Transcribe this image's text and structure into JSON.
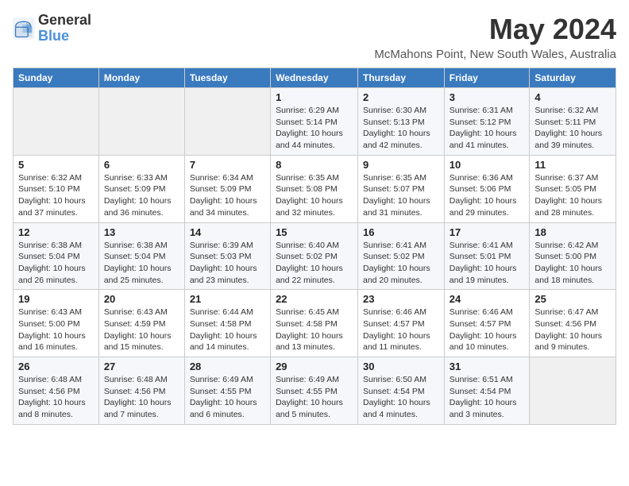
{
  "logo": {
    "line1": "General",
    "line2": "Blue"
  },
  "title": "May 2024",
  "location": "McMahons Point, New South Wales, Australia",
  "days_of_week": [
    "Sunday",
    "Monday",
    "Tuesday",
    "Wednesday",
    "Thursday",
    "Friday",
    "Saturday"
  ],
  "weeks": [
    [
      {
        "day": "",
        "info": ""
      },
      {
        "day": "",
        "info": ""
      },
      {
        "day": "",
        "info": ""
      },
      {
        "day": "1",
        "info": "Sunrise: 6:29 AM\nSunset: 5:14 PM\nDaylight: 10 hours\nand 44 minutes."
      },
      {
        "day": "2",
        "info": "Sunrise: 6:30 AM\nSunset: 5:13 PM\nDaylight: 10 hours\nand 42 minutes."
      },
      {
        "day": "3",
        "info": "Sunrise: 6:31 AM\nSunset: 5:12 PM\nDaylight: 10 hours\nand 41 minutes."
      },
      {
        "day": "4",
        "info": "Sunrise: 6:32 AM\nSunset: 5:11 PM\nDaylight: 10 hours\nand 39 minutes."
      }
    ],
    [
      {
        "day": "5",
        "info": "Sunrise: 6:32 AM\nSunset: 5:10 PM\nDaylight: 10 hours\nand 37 minutes."
      },
      {
        "day": "6",
        "info": "Sunrise: 6:33 AM\nSunset: 5:09 PM\nDaylight: 10 hours\nand 36 minutes."
      },
      {
        "day": "7",
        "info": "Sunrise: 6:34 AM\nSunset: 5:09 PM\nDaylight: 10 hours\nand 34 minutes."
      },
      {
        "day": "8",
        "info": "Sunrise: 6:35 AM\nSunset: 5:08 PM\nDaylight: 10 hours\nand 32 minutes."
      },
      {
        "day": "9",
        "info": "Sunrise: 6:35 AM\nSunset: 5:07 PM\nDaylight: 10 hours\nand 31 minutes."
      },
      {
        "day": "10",
        "info": "Sunrise: 6:36 AM\nSunset: 5:06 PM\nDaylight: 10 hours\nand 29 minutes."
      },
      {
        "day": "11",
        "info": "Sunrise: 6:37 AM\nSunset: 5:05 PM\nDaylight: 10 hours\nand 28 minutes."
      }
    ],
    [
      {
        "day": "12",
        "info": "Sunrise: 6:38 AM\nSunset: 5:04 PM\nDaylight: 10 hours\nand 26 minutes."
      },
      {
        "day": "13",
        "info": "Sunrise: 6:38 AM\nSunset: 5:04 PM\nDaylight: 10 hours\nand 25 minutes."
      },
      {
        "day": "14",
        "info": "Sunrise: 6:39 AM\nSunset: 5:03 PM\nDaylight: 10 hours\nand 23 minutes."
      },
      {
        "day": "15",
        "info": "Sunrise: 6:40 AM\nSunset: 5:02 PM\nDaylight: 10 hours\nand 22 minutes."
      },
      {
        "day": "16",
        "info": "Sunrise: 6:41 AM\nSunset: 5:02 PM\nDaylight: 10 hours\nand 20 minutes."
      },
      {
        "day": "17",
        "info": "Sunrise: 6:41 AM\nSunset: 5:01 PM\nDaylight: 10 hours\nand 19 minutes."
      },
      {
        "day": "18",
        "info": "Sunrise: 6:42 AM\nSunset: 5:00 PM\nDaylight: 10 hours\nand 18 minutes."
      }
    ],
    [
      {
        "day": "19",
        "info": "Sunrise: 6:43 AM\nSunset: 5:00 PM\nDaylight: 10 hours\nand 16 minutes."
      },
      {
        "day": "20",
        "info": "Sunrise: 6:43 AM\nSunset: 4:59 PM\nDaylight: 10 hours\nand 15 minutes."
      },
      {
        "day": "21",
        "info": "Sunrise: 6:44 AM\nSunset: 4:58 PM\nDaylight: 10 hours\nand 14 minutes."
      },
      {
        "day": "22",
        "info": "Sunrise: 6:45 AM\nSunset: 4:58 PM\nDaylight: 10 hours\nand 13 minutes."
      },
      {
        "day": "23",
        "info": "Sunrise: 6:46 AM\nSunset: 4:57 PM\nDaylight: 10 hours\nand 11 minutes."
      },
      {
        "day": "24",
        "info": "Sunrise: 6:46 AM\nSunset: 4:57 PM\nDaylight: 10 hours\nand 10 minutes."
      },
      {
        "day": "25",
        "info": "Sunrise: 6:47 AM\nSunset: 4:56 PM\nDaylight: 10 hours\nand 9 minutes."
      }
    ],
    [
      {
        "day": "26",
        "info": "Sunrise: 6:48 AM\nSunset: 4:56 PM\nDaylight: 10 hours\nand 8 minutes."
      },
      {
        "day": "27",
        "info": "Sunrise: 6:48 AM\nSunset: 4:56 PM\nDaylight: 10 hours\nand 7 minutes."
      },
      {
        "day": "28",
        "info": "Sunrise: 6:49 AM\nSunset: 4:55 PM\nDaylight: 10 hours\nand 6 minutes."
      },
      {
        "day": "29",
        "info": "Sunrise: 6:49 AM\nSunset: 4:55 PM\nDaylight: 10 hours\nand 5 minutes."
      },
      {
        "day": "30",
        "info": "Sunrise: 6:50 AM\nSunset: 4:54 PM\nDaylight: 10 hours\nand 4 minutes."
      },
      {
        "day": "31",
        "info": "Sunrise: 6:51 AM\nSunset: 4:54 PM\nDaylight: 10 hours\nand 3 minutes."
      },
      {
        "day": "",
        "info": ""
      }
    ]
  ]
}
